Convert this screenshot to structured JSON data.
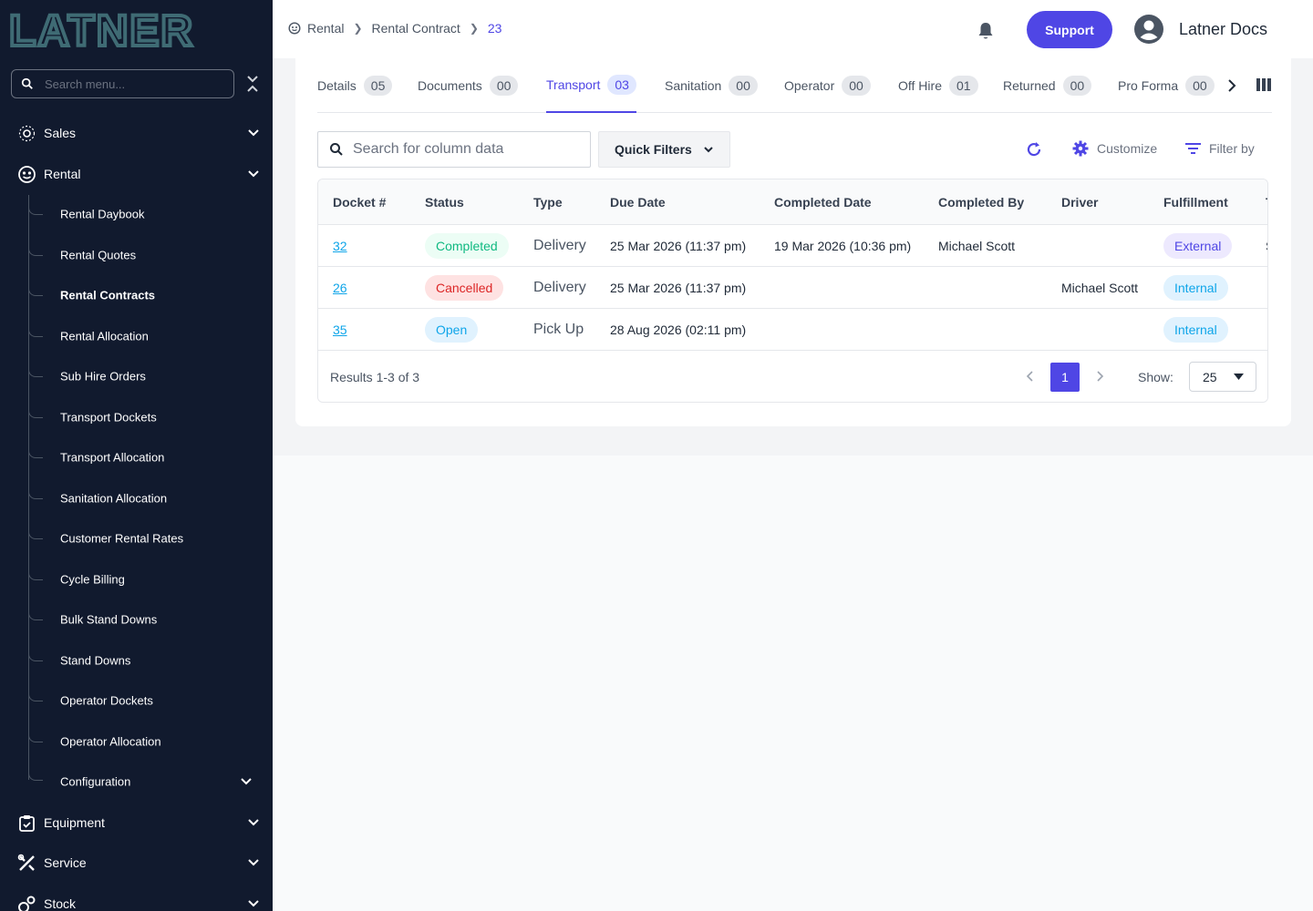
{
  "app": {
    "logo_text": "LATNER"
  },
  "sidebar": {
    "search_placeholder": "Search menu...",
    "items": [
      {
        "label": "Sales",
        "icon": "sales-icon"
      },
      {
        "label": "Rental",
        "icon": "rental-icon"
      },
      {
        "label": "Equipment",
        "icon": "equipment-icon"
      },
      {
        "label": "Service",
        "icon": "service-icon"
      },
      {
        "label": "Stock",
        "icon": "stock-icon"
      }
    ],
    "rental_sub": [
      "Rental Daybook",
      "Rental Quotes",
      "Rental Contracts",
      "Rental Allocation",
      "Sub Hire Orders",
      "Transport Dockets",
      "Transport Allocation",
      "Sanitation Allocation",
      "Customer Rental Rates",
      "Cycle Billing",
      "Bulk Stand Downs",
      "Stand Downs",
      "Operator Dockets",
      "Operator Allocation",
      "Configuration"
    ],
    "active_sub": "Rental Contracts"
  },
  "header": {
    "breadcrumb": [
      "Rental",
      "Rental Contract",
      "23"
    ],
    "support_label": "Support",
    "user_name": "Latner Docs"
  },
  "tabs": [
    {
      "label": "Details",
      "count": "05"
    },
    {
      "label": "Documents",
      "count": "00"
    },
    {
      "label": "Transport",
      "count": "03",
      "active": true
    },
    {
      "label": "Sanitation",
      "count": "00"
    },
    {
      "label": "Operator",
      "count": "00"
    },
    {
      "label": "Off Hire",
      "count": "01"
    },
    {
      "label": "Returned",
      "count": "00"
    },
    {
      "label": "Pro Forma",
      "count": "00"
    }
  ],
  "toolbar": {
    "search_placeholder": "Search for column data",
    "quick_filters_label": "Quick Filters",
    "customize_label": "Customize",
    "filter_label": "Filter by"
  },
  "table": {
    "columns": [
      "Docket #",
      "Status",
      "Type",
      "Due Date",
      "Completed Date",
      "Completed By",
      "Driver",
      "Fulfillment",
      "T"
    ],
    "rows": [
      {
        "docket": "32",
        "status": "Completed",
        "type": "Delivery",
        "due": "25 Mar 2026 (11:37 pm)",
        "completed_date": "19 Mar 2026 (10:36 pm)",
        "completed_by": "Michael Scott",
        "driver": "",
        "fulfillment": "External",
        "overflow": "S"
      },
      {
        "docket": "26",
        "status": "Cancelled",
        "type": "Delivery",
        "due": "25 Mar 2026 (11:37 pm)",
        "completed_date": "",
        "completed_by": "",
        "driver": "Michael Scott",
        "fulfillment": "Internal",
        "overflow": ""
      },
      {
        "docket": "35",
        "status": "Open",
        "type": "Pick Up",
        "due": "28 Aug 2026 (02:11 pm)",
        "completed_date": "",
        "completed_by": "",
        "driver": "",
        "fulfillment": "Internal",
        "overflow": ""
      }
    ]
  },
  "pagination": {
    "results_text": "Results 1-3 of 3",
    "current_page": "1",
    "show_label": "Show:",
    "page_size": "25"
  },
  "colors": {
    "sidebar_bg": "#111a2e",
    "accent": "#4f46e5",
    "link": "#0ea5e9"
  }
}
